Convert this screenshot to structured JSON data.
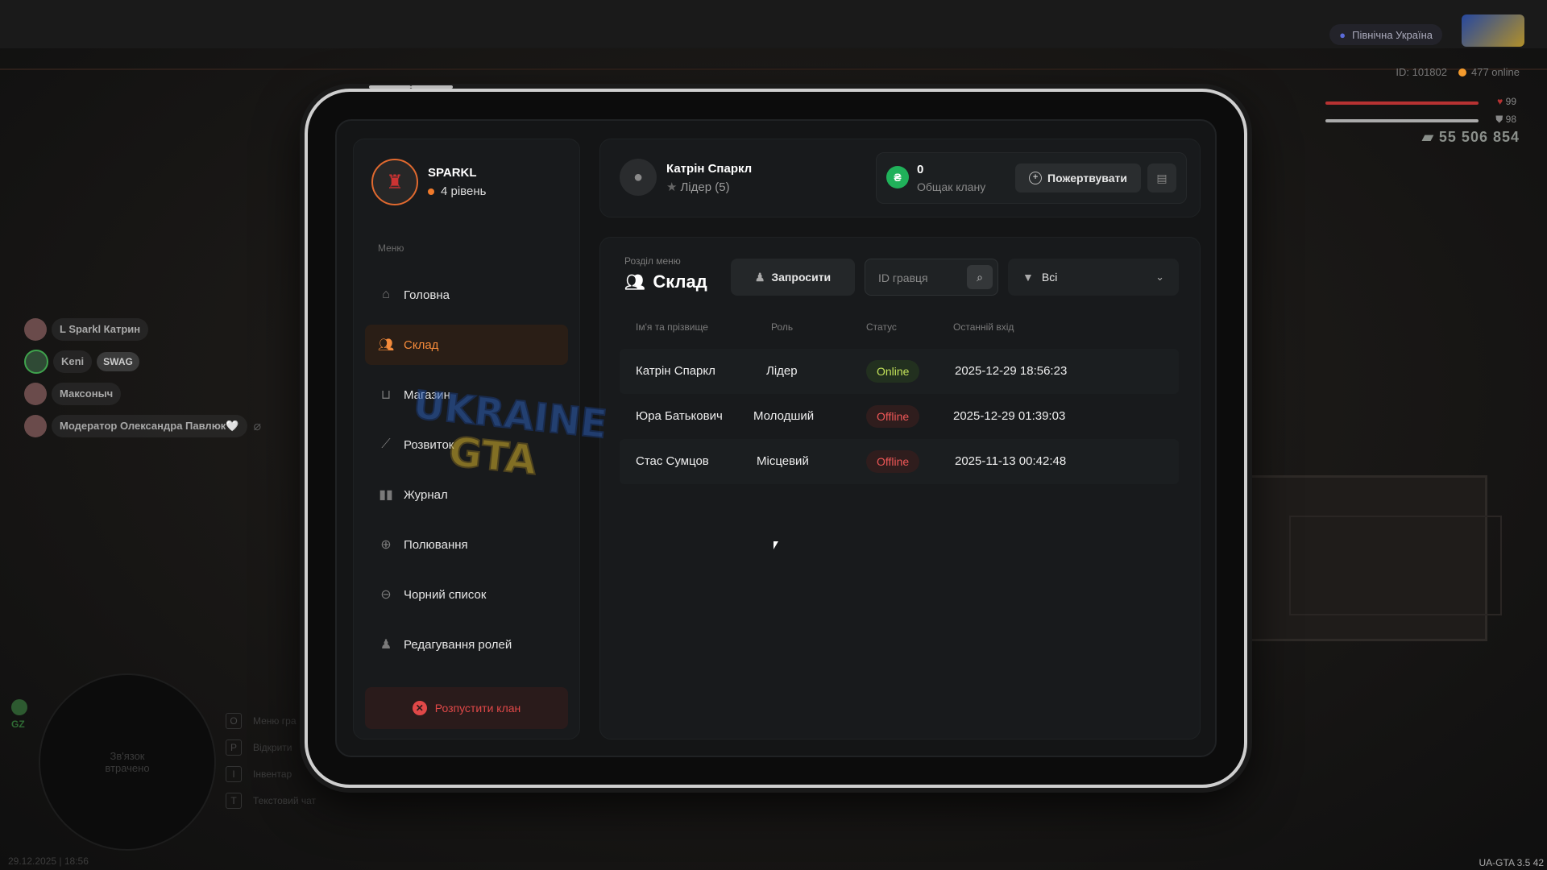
{
  "hud": {
    "region": "Північна Україна",
    "player_id": "ID: 101802",
    "online": "477 online",
    "health": "99",
    "armor": "98",
    "money": "55 506 854"
  },
  "voice_chat": [
    {
      "name": "L Sparkl Катрин",
      "tag": ""
    },
    {
      "name": "Keni",
      "tag": "SWAG"
    },
    {
      "name": "Максоныч",
      "tag": ""
    },
    {
      "name": "Модератор Олександра Павлюк🤍",
      "tag": ""
    }
  ],
  "minimap": {
    "status": "Зв'язок втрачено",
    "zone": "GZ"
  },
  "key_hints": [
    {
      "key": "O",
      "label": "Меню гра"
    },
    {
      "key": "P",
      "label": "Відкрити"
    },
    {
      "key": "I",
      "label": "Інвентар"
    },
    {
      "key": "T",
      "label": "Текстовий чат"
    }
  ],
  "datetime": "29.12.2025 | 18:56",
  "version": "UA-GTA 3.5",
  "version_fps": "42",
  "profile": {
    "name": "SPARKL",
    "level": "4 рівень"
  },
  "sidebar": {
    "menu_title": "Меню",
    "items": [
      {
        "label": "Головна",
        "icon": "home-icon"
      },
      {
        "label": "Склад",
        "icon": "people-icon"
      },
      {
        "label": "Магазин",
        "icon": "basket-icon"
      },
      {
        "label": "Розвиток",
        "icon": "chart-icon"
      },
      {
        "label": "Журнал",
        "icon": "book-icon"
      },
      {
        "label": "Полювання",
        "icon": "crosshair-icon"
      },
      {
        "label": "Чорний список",
        "icon": "block-icon"
      },
      {
        "label": "Редагування ролей",
        "icon": "user-edit-icon"
      }
    ],
    "disband_label": "Розпустити клан"
  },
  "header": {
    "user_name": "Катрін Спаркл",
    "user_role": "Лідер (5)",
    "bank_value": "0",
    "bank_label": "Общак клану",
    "donate_label": "Пожертвувати"
  },
  "section": {
    "label": "Розділ меню",
    "title": "Склад",
    "invite_label": "Запросити",
    "search_placeholder": "ID гравця",
    "filter_value": "Всі"
  },
  "table": {
    "columns": [
      "Ім'я та прізвище",
      "Роль",
      "Статус",
      "Останній вхід"
    ],
    "rows": [
      {
        "name": "Катрін Спаркл",
        "role": "Лідер",
        "status": "Online",
        "last": "2025-12-29 18:56:23"
      },
      {
        "name": "Юра Батькович",
        "role": "Молодший",
        "status": "Offline",
        "last": "2025-12-29 01:39:03"
      },
      {
        "name": "Стас Сумцов",
        "role": "Місцевий",
        "status": "Offline",
        "last": "2025-11-13 00:42:48"
      }
    ]
  },
  "watermark": [
    "UKRAINE",
    "GTA"
  ],
  "colors": {
    "accent": "#f58b3b",
    "online": "#c4e35a",
    "offline": "#ef5757",
    "bank": "#20b15a",
    "danger": "#e04848"
  }
}
